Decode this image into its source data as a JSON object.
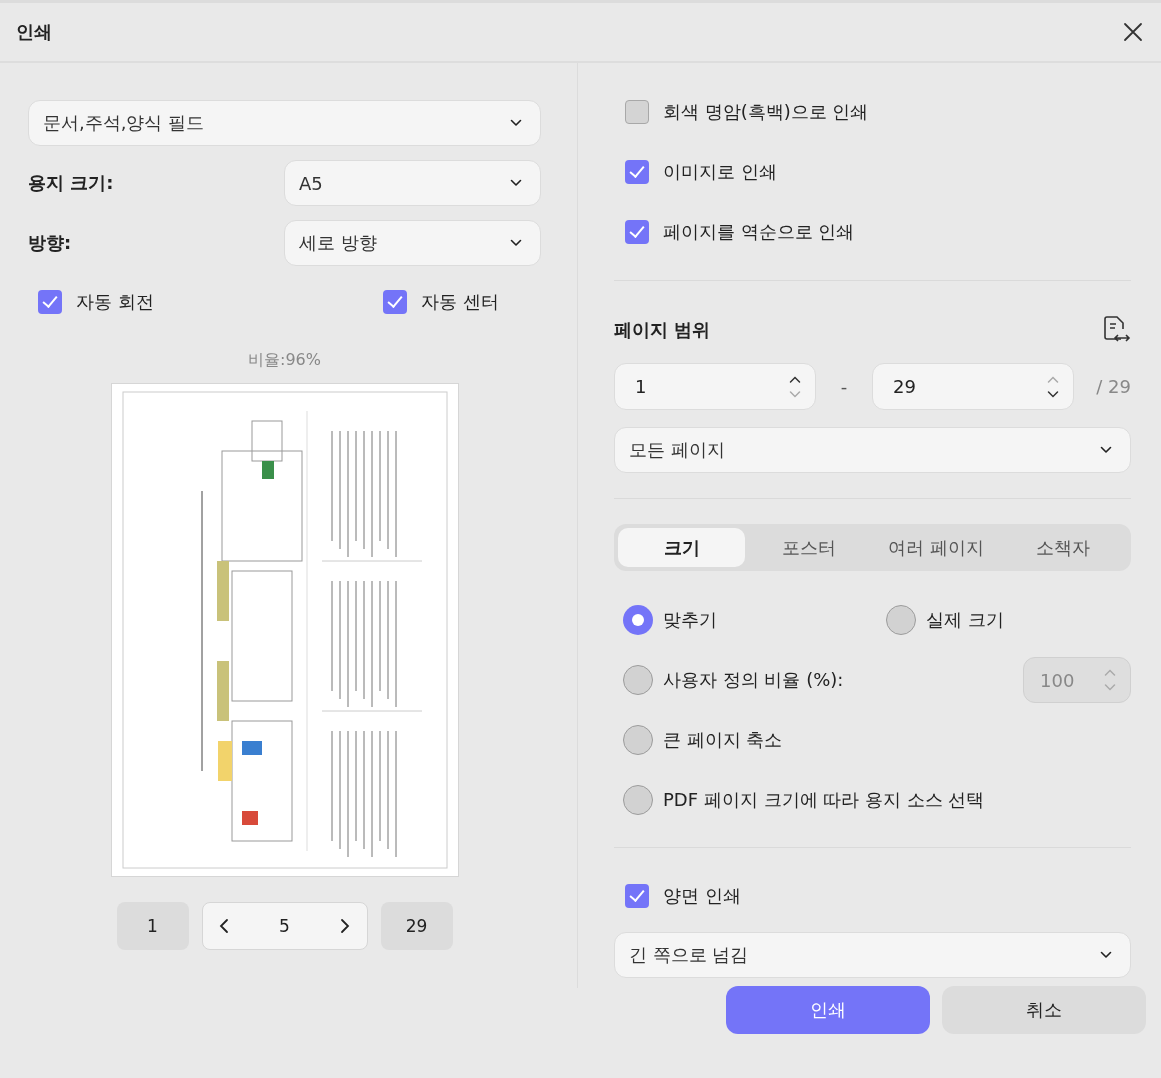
{
  "window": {
    "title": "인쇄"
  },
  "left": {
    "content_select": {
      "value": "문서,주석,양식 필드"
    },
    "paper_size": {
      "label": "용지 크기:",
      "value": "A5"
    },
    "orientation": {
      "label": "방향:",
      "value": "세로 방향"
    },
    "options": [
      {
        "label": "자동 회전",
        "checked": true
      },
      {
        "label": "자동 센터",
        "checked": true
      }
    ],
    "scale_text": "비율:96%",
    "pager": {
      "first": "1",
      "current": "5",
      "last": "29"
    }
  },
  "right": {
    "print_options": [
      {
        "label": "회색 명암(흑백)으로 인쇄",
        "checked": false
      },
      {
        "label": "이미지로 인쇄",
        "checked": true
      },
      {
        "label": "페이지를 역순으로 인쇄",
        "checked": true
      }
    ],
    "page_range": {
      "title": "페이지 범위",
      "from": "1",
      "separator": "-",
      "to": "29",
      "total": "/ 29",
      "subset": "모든 페이지"
    },
    "tabs": [
      {
        "label": "크기",
        "selected": true
      },
      {
        "label": "포스터",
        "selected": false
      },
      {
        "label": "여러 페이지",
        "selected": false
      },
      {
        "label": "소책자",
        "selected": false
      }
    ],
    "sizing": [
      {
        "label": "맞추기",
        "selected": true
      },
      {
        "label": "실제 크기",
        "selected": false
      },
      {
        "label": "사용자 정의 비율 (%):",
        "selected": false
      },
      {
        "label": "큰 페이지 축소",
        "selected": false
      },
      {
        "label": "PDF 페이지 크기에 따라 용지 소스 선택",
        "selected": false
      }
    ],
    "custom_scale": {
      "value": "100",
      "disabled": true
    },
    "duplex": {
      "label": "양면 인쇄",
      "checked": true,
      "flip": "긴 쪽으로 넘김"
    }
  },
  "buttons": [
    {
      "label": "인쇄",
      "kind": "primary"
    },
    {
      "label": "취소",
      "kind": "secondary"
    }
  ]
}
